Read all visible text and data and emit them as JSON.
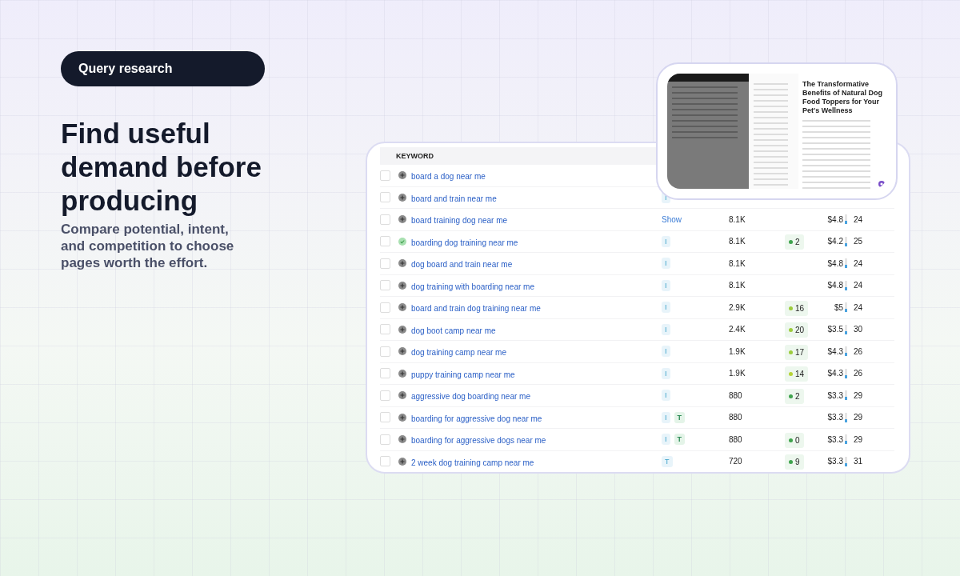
{
  "badge": "Query research",
  "headline": "Find useful demand before producing",
  "subtitle": "Compare potential, intent, and competition to choose pages worth the effort.",
  "table": {
    "columns": [
      "KEYWORD"
    ],
    "rows": [
      {
        "keyword": "board a dog near me",
        "checked": false,
        "added": false
      },
      {
        "keyword": "board and train near me",
        "checked": false,
        "added": false,
        "intent": [
          "I"
        ]
      },
      {
        "keyword": "board training dog near me",
        "checked": false,
        "added": false,
        "intent_link": "Show",
        "volume": "8.1K",
        "cpc": "$4.8",
        "column_6": "24"
      },
      {
        "keyword": "boarding dog training near me",
        "checked": false,
        "added": true,
        "intent": [
          "I"
        ],
        "volume": "8.1K",
        "kd": {
          "value": "2",
          "color": "#3fa34d"
        },
        "cpc": "$4.2",
        "column_6": "25"
      },
      {
        "keyword": "dog board and train near me",
        "checked": false,
        "added": false,
        "intent": [
          "I"
        ],
        "volume": "8.1K",
        "cpc": "$4.8",
        "column_6": "24"
      },
      {
        "keyword": "dog training with boarding near me",
        "checked": false,
        "added": false,
        "intent": [
          "I"
        ],
        "volume": "8.1K",
        "cpc": "$4.8",
        "column_6": "24"
      },
      {
        "keyword": "board and train dog training near me",
        "checked": false,
        "added": false,
        "intent": [
          "I"
        ],
        "volume": "2.9K",
        "kd": {
          "value": "16",
          "color": "#9ccc3c"
        },
        "cpc": "$5",
        "column_6": "24"
      },
      {
        "keyword": "dog boot camp near me",
        "checked": false,
        "added": false,
        "intent": [
          "I"
        ],
        "volume": "2.4K",
        "kd": {
          "value": "20",
          "color": "#9ccc3c"
        },
        "cpc": "$3.5",
        "column_6": "30"
      },
      {
        "keyword": "dog training camp near me",
        "checked": false,
        "added": false,
        "intent": [
          "I"
        ],
        "volume": "1.9K",
        "kd": {
          "value": "17",
          "color": "#9ccc3c"
        },
        "cpc": "$4.3",
        "column_6": "26"
      },
      {
        "keyword": "puppy training camp near me",
        "checked": false,
        "added": false,
        "intent": [
          "I"
        ],
        "volume": "1.9K",
        "kd": {
          "value": "14",
          "color": "#b5d334"
        },
        "cpc": "$4.3",
        "column_6": "26"
      },
      {
        "keyword": "aggressive dog boarding near me",
        "checked": false,
        "added": false,
        "intent": [
          "I"
        ],
        "volume": "880",
        "kd": {
          "value": "2",
          "color": "#3fa34d"
        },
        "cpc": "$3.3",
        "column_6": "29"
      },
      {
        "keyword": "boarding for aggressive dog near me",
        "checked": false,
        "added": false,
        "intent": [
          "I",
          "T"
        ],
        "volume": "880",
        "cpc": "$3.3",
        "column_6": "29"
      },
      {
        "keyword": "boarding for aggressive dogs near me",
        "checked": false,
        "added": false,
        "intent": [
          "I",
          "T"
        ],
        "volume": "880",
        "kd": {
          "value": "0",
          "color": "#3fa34d"
        },
        "cpc": "$3.3",
        "column_6": "29"
      },
      {
        "keyword": "2 week dog training camp near me",
        "checked": false,
        "added": false,
        "intent": [
          "T"
        ],
        "volume": "720",
        "kd": {
          "value": "9",
          "color": "#3fa34d"
        },
        "cpc": "$3.3",
        "column_6": "31"
      }
    ]
  },
  "preview": {
    "article_title": "The Transformative Benefits of Natural Dog Food Toppers for Your Pet's Wellness"
  }
}
